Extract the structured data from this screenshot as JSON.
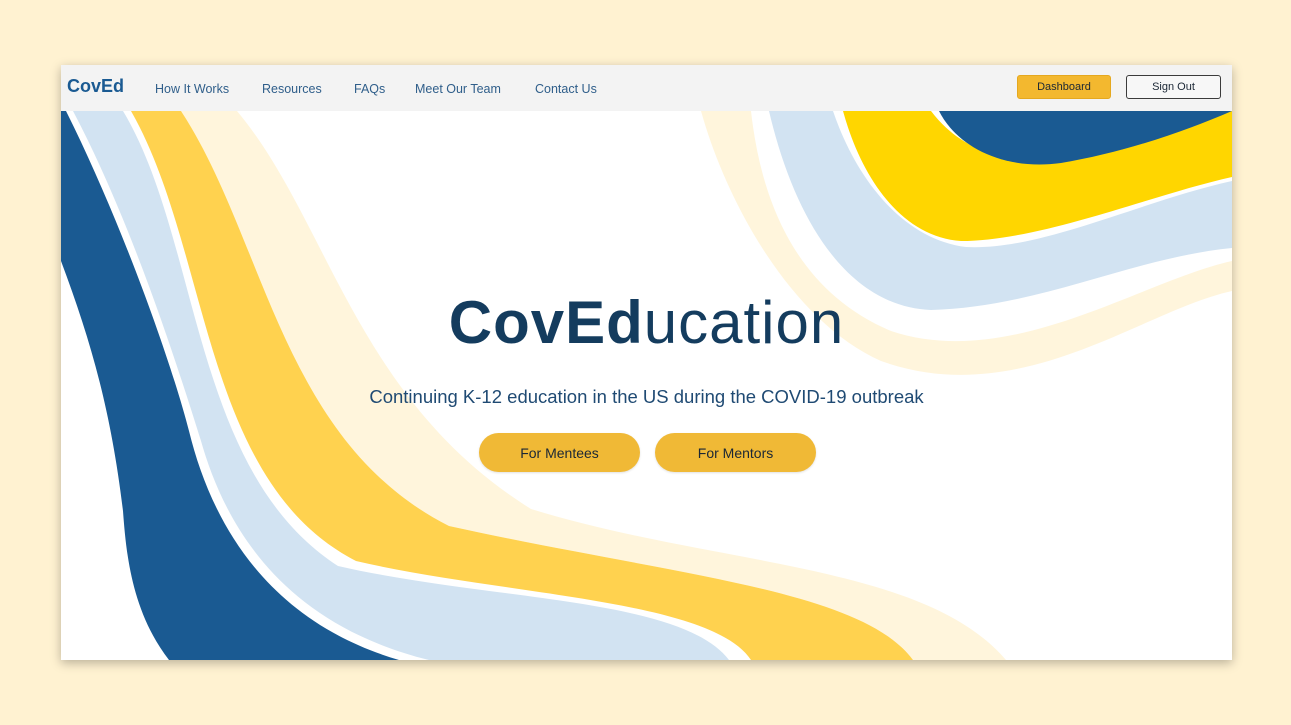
{
  "nav": {
    "brand": "CovEd",
    "links": [
      "How It Works",
      "Resources",
      "FAQs",
      "Meet Our Team",
      "Contact Us"
    ],
    "dashboard_label": "Dashboard",
    "signout_label": "Sign Out"
  },
  "hero": {
    "title_bold": "CovEd",
    "title_light": "ucation",
    "subtitle": "Continuing K-12 education in the US during the COVID-19 outbreak",
    "mentees_label": "For Mentees",
    "mentors_label": "For Mentors"
  },
  "colors": {
    "page_background": "#fff2d1",
    "navy": "#1a5a92",
    "light_blue": "#d2e3f2",
    "mustard": "#ffd24f",
    "yellow": "#ffd600",
    "cream": "#fff5dc",
    "accent": "#f0b936"
  }
}
